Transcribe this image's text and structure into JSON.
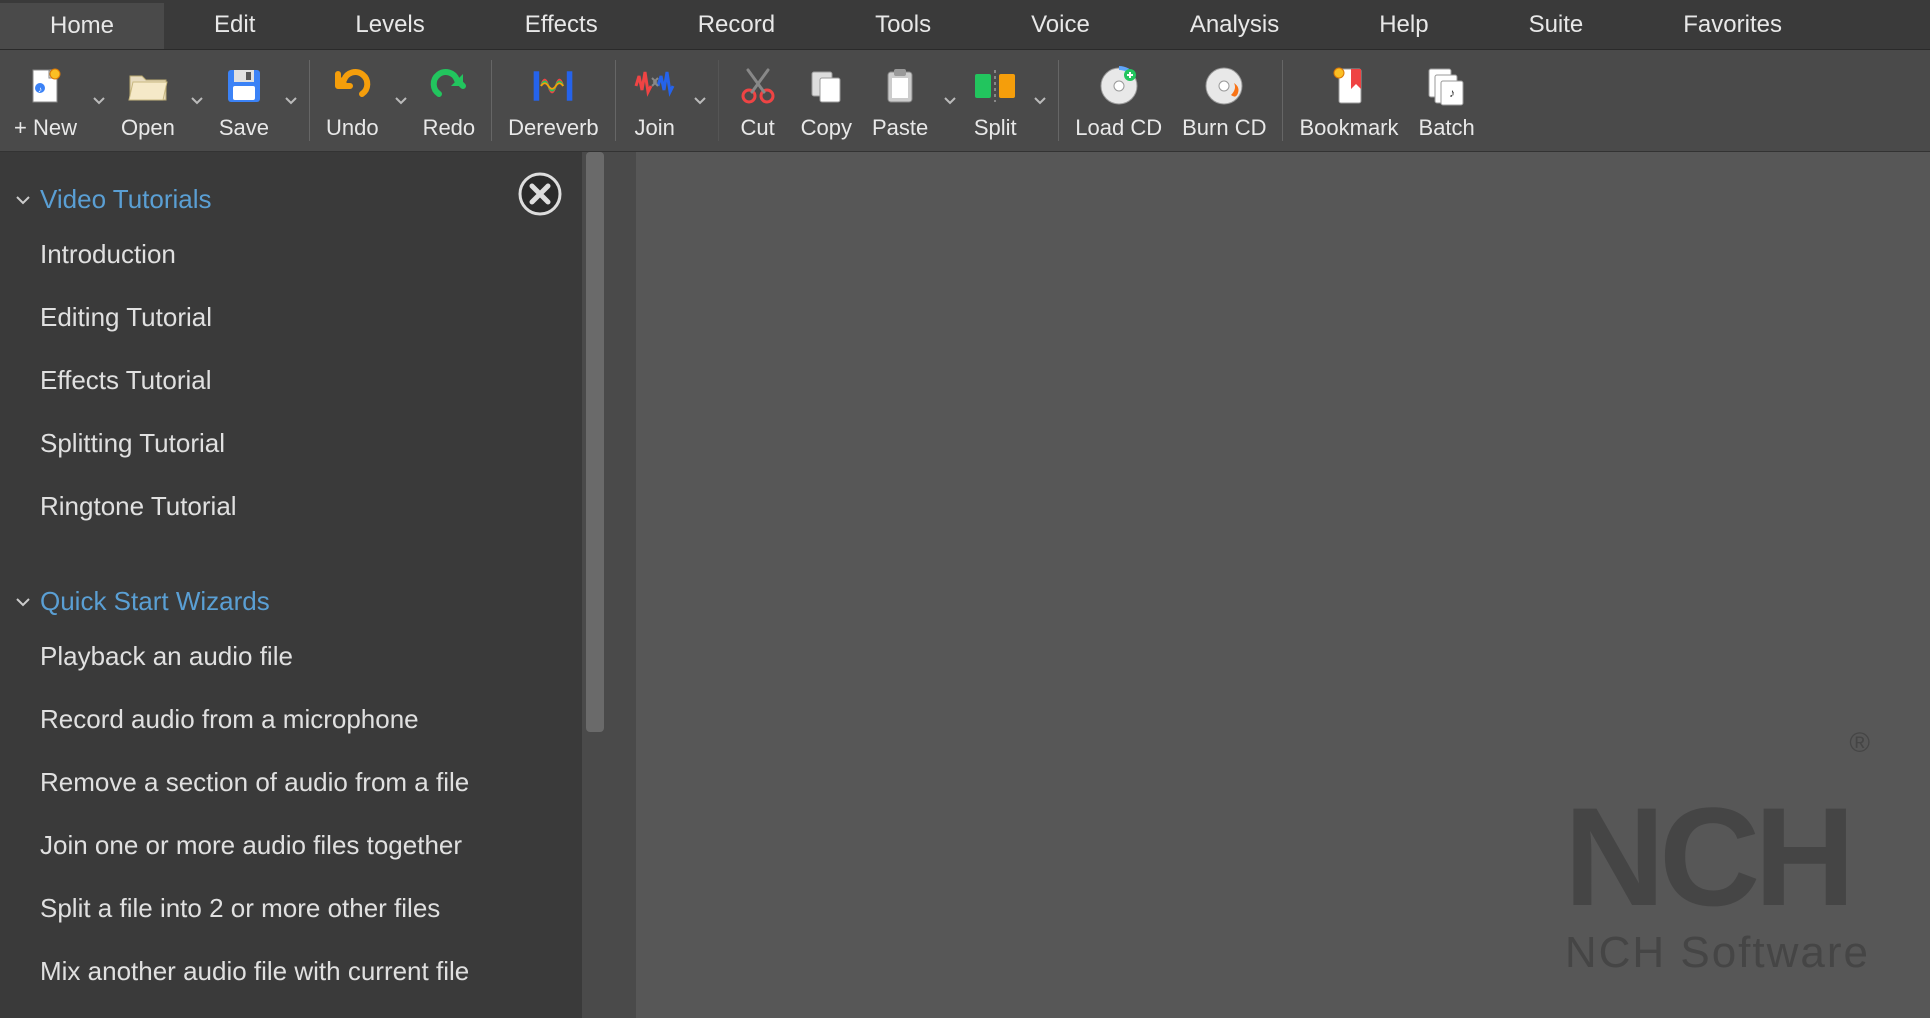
{
  "menu": {
    "tabs": [
      "Home",
      "Edit",
      "Levels",
      "Effects",
      "Record",
      "Tools",
      "Voice",
      "Analysis",
      "Help",
      "Suite",
      "Favorites"
    ],
    "active": 0
  },
  "toolbar": {
    "new": "+ New",
    "open": "Open",
    "save": "Save",
    "undo": "Undo",
    "redo": "Redo",
    "dereverb": "Dereverb",
    "join": "Join",
    "cut": "Cut",
    "copy": "Copy",
    "paste": "Paste",
    "split": "Split",
    "loadcd": "Load CD",
    "burncd": "Burn CD",
    "bookmark": "Bookmark",
    "batch": "Batch"
  },
  "sidebar": {
    "section1": {
      "title": "Video Tutorials",
      "items": [
        "Introduction",
        "Editing Tutorial",
        "Effects Tutorial",
        "Splitting Tutorial",
        "Ringtone Tutorial"
      ]
    },
    "section2": {
      "title": "Quick Start Wizards",
      "items": [
        "Playback an audio file",
        "Record audio from a microphone",
        "Remove a section of audio from a file",
        "Join one or more audio files together",
        "Split a file into 2 or more other files",
        "Mix another audio file with current file"
      ]
    }
  },
  "brand": {
    "logo": "NCH",
    "reg": "®",
    "sub": "NCH Software"
  }
}
